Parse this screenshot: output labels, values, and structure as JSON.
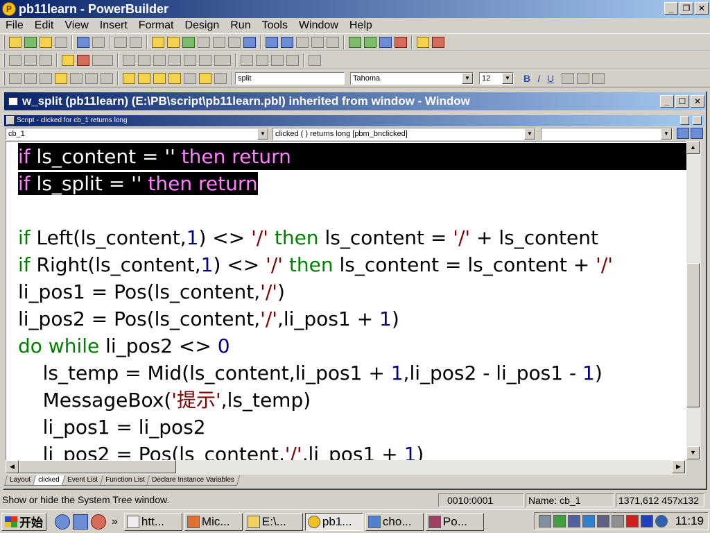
{
  "app": {
    "title": "pb11learn - PowerBuilder"
  },
  "menu": [
    "File",
    "Edit",
    "View",
    "Insert",
    "Format",
    "Design",
    "Run",
    "Tools",
    "Window",
    "Help"
  ],
  "toolbar3": {
    "text_field": "split",
    "font": "Tahoma",
    "font_size": "12",
    "bold": "B",
    "italic": "I",
    "underline": "U"
  },
  "window": {
    "title": "w_split (pb11learn) (E:\\PB\\script\\pb11learn.pbl) inherited from window - Window"
  },
  "script": {
    "title": "Script - clicked for cb_1 returns long",
    "object": "cb_1",
    "event": "clicked ( )  returns long [pbm_bnclicked]"
  },
  "code": {
    "line1": {
      "a": "if",
      "b": " ls_content = '' ",
      "c": "then return"
    },
    "line2": {
      "a": "if",
      "b": " ls_split = '' ",
      "c": "then return"
    },
    "line3": {
      "a": "if",
      "b": " Left(ls_content,",
      "n": "1",
      "c": ") <> ",
      "s": "'/'",
      "d": " then",
      "e": " ls_content = ",
      "s2": "'/'",
      "f": " + ls_content"
    },
    "line4": {
      "a": "if",
      "b": " Right(ls_content,",
      "n": "1",
      "c": ") <> ",
      "s": "'/'",
      "d": " then",
      "e": " ls_content = ls_content + ",
      "s2": "'/'"
    },
    "line5": {
      "a": "li_pos1 = Pos(ls_content,",
      "s": "'/'",
      "b": ")"
    },
    "line6": {
      "a": "li_pos2 = Pos(ls_content,",
      "s": "'/'",
      "b": ",li_pos1 + ",
      "n": "1",
      "c": ")"
    },
    "line7": {
      "a": "do while",
      "b": " li_pos2 <> ",
      "n": "0"
    },
    "line8": {
      "a": "    ls_temp = Mid(ls_content,li_pos1 + ",
      "n1": "1",
      "b": ",li_pos2 - li_pos1 - ",
      "n2": "1",
      "c": ")"
    },
    "line9": {
      "a": "    MessageBox(",
      "s": "'提示'",
      "b": ",ls_temp)"
    },
    "line10": {
      "a": "    li_pos1 = li_pos2"
    },
    "line11": {
      "a": "    li_pos2 = Pos(ls_content,",
      "s": "'/'",
      "b": ",li_pos1 + ",
      "n": "1",
      "c": ")"
    }
  },
  "tabs": [
    "Layout",
    "clicked",
    "Event List",
    "Function List",
    "Declare Instance Variables"
  ],
  "status": {
    "message": "Show or hide the System Tree window.",
    "position": "0010:0001",
    "name": "Name: cb_1",
    "coords": "1371,612 457x132"
  },
  "taskbar": {
    "start": "开始",
    "chevron": "»",
    "tasks": [
      "htt...",
      "Mic...",
      "E:\\...",
      "pb1...",
      "cho...",
      "Po..."
    ],
    "clock": "11:19"
  }
}
